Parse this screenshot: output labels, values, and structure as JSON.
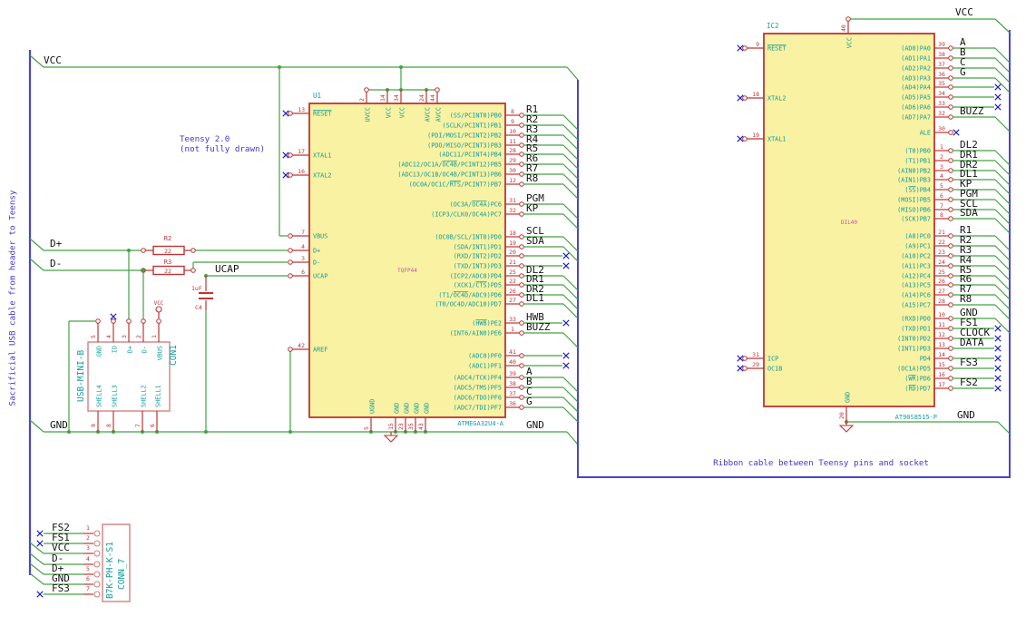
{
  "schematic": {
    "notes": {
      "teensy1": "Teensy 2.0",
      "teensy2": "(not fully drawn)",
      "ribbon": "Ribbon cable between Teensy pins and socket",
      "cable": "Sacrificial USB cable from header to Teensy"
    },
    "colors": {
      "wire": "#44a244",
      "pin": "#bf3434",
      "fill": "#f8f2a2",
      "name": "#109e9e",
      "value": "#c24fc2",
      "note": "#4238cc",
      "frame": "#4a44cc",
      "nc": "#1818c8",
      "label": "#141414",
      "connector": "#d47f7f"
    },
    "net_labels": {
      "vcc": "VCC",
      "gnd": "GND",
      "dplus": "D+",
      "dminus": "D-",
      "ucap": "UCAP"
    },
    "power_flag": "VCC",
    "resistors": [
      {
        "ref": "R2",
        "value": "22"
      },
      {
        "ref": "R3",
        "value": "22"
      }
    ],
    "capacitors": [
      {
        "ref": "C4",
        "value": "1uF"
      }
    ],
    "chips": [
      {
        "ref": "U1",
        "part": "ATMEGA32U4-A",
        "package": "TQFP44",
        "left": [
          {
            "num": "13",
            "name": "~RESET~",
            "nc": true
          },
          {
            "num": "17",
            "name": "XTAL1",
            "nc": true
          },
          {
            "num": "16",
            "name": "XTAL2",
            "nc": true
          },
          {
            "num": "7",
            "name": "VBUS"
          },
          {
            "num": "4",
            "name": "D+"
          },
          {
            "num": "3",
            "name": "D-"
          },
          {
            "num": "6",
            "name": "UCAP"
          },
          {
            "num": "42",
            "name": "AREF"
          }
        ],
        "top": [
          {
            "num": "2",
            "name": "UVCC"
          },
          {
            "num": "14",
            "name": "VCC"
          },
          {
            "num": "34",
            "name": "VCC"
          },
          {
            "num": "24",
            "name": "AVCC"
          },
          {
            "num": "44",
            "name": "AVCC"
          }
        ],
        "bottom": [
          {
            "num": "5",
            "name": "UGND"
          },
          {
            "num": "15",
            "name": "GND"
          },
          {
            "num": "23",
            "name": "GND"
          },
          {
            "num": "35",
            "name": "GND"
          },
          {
            "num": "43",
            "name": "GND"
          }
        ],
        "right": [
          {
            "num": "8",
            "name": "(SS/PCINT0)PB0",
            "label": "R1",
            "conn": "bus"
          },
          {
            "num": "9",
            "name": "(SCLK/PCINT1)PB1",
            "label": "R2",
            "conn": "bus"
          },
          {
            "num": "10",
            "name": "(PDI/MOSI/PCINT2)PB2",
            "label": "R3",
            "conn": "bus"
          },
          {
            "num": "11",
            "name": "(PDO/MISO/PCINT3)PB3",
            "label": "R4",
            "conn": "bus"
          },
          {
            "num": "28",
            "name": "(ADC11/PCINT4)PB4",
            "label": "R5",
            "conn": "bus"
          },
          {
            "num": "29",
            "name": "(ADC12/OC1A/~OC4B~/PCINT12)PB5",
            "label": "R6",
            "conn": "bus"
          },
          {
            "num": "30",
            "name": "(ADC13/OC1B/OC4B/PCINT13)PB6",
            "label": "R7",
            "conn": "bus"
          },
          {
            "num": "12",
            "name": "(OC0A/OC1C/~RTS~/PCINT7)PB7",
            "label": "R8",
            "conn": "bus"
          },
          {
            "num": "31",
            "name": "(OC3A/~OC4A~)PC6",
            "label": "PGM",
            "conn": "bus"
          },
          {
            "num": "32",
            "name": "(ICP3/CLK0/OC4A)PC7",
            "label": "KP",
            "conn": "bus"
          },
          {
            "num": "18",
            "name": "(OC0B/SCL/INT0)PD0",
            "label": "SCL",
            "conn": "bus"
          },
          {
            "num": "19",
            "name": "(SDA/INT1)PD1",
            "label": "SDA",
            "conn": "bus"
          },
          {
            "num": "20",
            "name": "(RXD/INT2)PD2",
            "label": "",
            "conn": "nc"
          },
          {
            "num": "21",
            "name": "(TXD/INT3)PD3",
            "label": "",
            "conn": "nc"
          },
          {
            "num": "25",
            "name": "(ICP2/ADC8)PD4",
            "label": "DL2",
            "conn": "bus"
          },
          {
            "num": "22",
            "name": "(XCK1/~CTS~)PD5",
            "label": "DR1",
            "conn": "bus"
          },
          {
            "num": "26",
            "name": "(T1/~OC4D~/ADC9)PD6",
            "label": "DR2",
            "conn": "bus"
          },
          {
            "num": "27",
            "name": "(T0/OC4D/ADC10)PD7",
            "label": "DL1",
            "conn": "bus"
          },
          {
            "num": "33",
            "name": "(~HWB~)PE2",
            "label": "HWB",
            "conn": "nc"
          },
          {
            "num": "1",
            "name": "(INT6/AIN0)PE6",
            "label": "BUZZ",
            "conn": "bus"
          },
          {
            "num": "41",
            "name": "(ADC0)PF0",
            "label": "",
            "conn": "nc"
          },
          {
            "num": "40",
            "name": "(ADC1)PF1",
            "label": "",
            "conn": "nc"
          },
          {
            "num": "39",
            "name": "(ADC4/TCK)PF4",
            "label": "A",
            "conn": "bus"
          },
          {
            "num": "38",
            "name": "(ADC5/TMS)PF5",
            "label": "B",
            "conn": "bus"
          },
          {
            "num": "37",
            "name": "(ADC6/TDO)PF6",
            "label": "C",
            "conn": "bus"
          },
          {
            "num": "36",
            "name": "(ADC7/TDI)PF7",
            "label": "G",
            "conn": "bus"
          }
        ]
      },
      {
        "ref": "IC2",
        "part": "AT90S8515-P",
        "package": "DIL40",
        "left": [
          {
            "num": "9",
            "name": "~RESET~",
            "nc": true
          },
          {
            "num": "18",
            "name": "XTAL2",
            "nc": true
          },
          {
            "num": "19",
            "name": "XTAL1",
            "nc": true
          },
          {
            "num": "31",
            "name": "ICP",
            "nc": true
          },
          {
            "num": "29",
            "name": "OC1B",
            "nc": true
          }
        ],
        "top": [
          {
            "num": "40",
            "name": "VCC"
          }
        ],
        "bottom": [
          {
            "num": "20",
            "name": "GND"
          }
        ],
        "right": [
          {
            "num": "39",
            "name": "(AD0)PA0",
            "label": "A",
            "conn": "bus"
          },
          {
            "num": "38",
            "name": "(AD1)PA1",
            "label": "B",
            "conn": "bus"
          },
          {
            "num": "37",
            "name": "(AD2)PA2",
            "label": "C",
            "conn": "bus"
          },
          {
            "num": "36",
            "name": "(AD3)PA3",
            "label": "G",
            "conn": "bus"
          },
          {
            "num": "35",
            "name": "(AD4)PA4",
            "label": "",
            "conn": "nc"
          },
          {
            "num": "34",
            "name": "(AD5)PA5",
            "label": "",
            "conn": "nc"
          },
          {
            "num": "33",
            "name": "(AD6)PA6",
            "label": "",
            "conn": "nc"
          },
          {
            "num": "32",
            "name": "(AD7)PA7",
            "label": "BUZZ",
            "conn": "bus"
          },
          {
            "num": "30",
            "name": "ALE",
            "label": "",
            "conn": "ncshort"
          },
          {
            "num": "1",
            "name": "(T0)PB0",
            "label": "DL2",
            "conn": "bus"
          },
          {
            "num": "2",
            "name": "(T1)PB1",
            "label": "DR1",
            "conn": "bus"
          },
          {
            "num": "3",
            "name": "(AIN0)PB2",
            "label": "DR2",
            "conn": "bus"
          },
          {
            "num": "4",
            "name": "(AIN1)PB3",
            "label": "DL1",
            "conn": "bus"
          },
          {
            "num": "5",
            "name": "(~SS~)PB4",
            "label": "KP",
            "conn": "bus"
          },
          {
            "num": "6",
            "name": "(MOSI)PB5",
            "label": "PGM",
            "conn": "bus"
          },
          {
            "num": "7",
            "name": "(MISO)PB6",
            "label": "SCL",
            "conn": "bus"
          },
          {
            "num": "8",
            "name": "(SCK)PB7",
            "label": "SDA",
            "conn": "bus"
          },
          {
            "num": "21",
            "name": "(A8)PC0",
            "label": "R1",
            "conn": "bus"
          },
          {
            "num": "22",
            "name": "(A9)PC1",
            "label": "R2",
            "conn": "bus"
          },
          {
            "num": "23",
            "name": "(A10)PC2",
            "label": "R3",
            "conn": "bus"
          },
          {
            "num": "24",
            "name": "(A11)PC3",
            "label": "R4",
            "conn": "bus"
          },
          {
            "num": "25",
            "name": "(A12)PC4",
            "label": "R5",
            "conn": "bus"
          },
          {
            "num": "26",
            "name": "(A13)PC5",
            "label": "R6",
            "conn": "bus"
          },
          {
            "num": "27",
            "name": "(A14)PC6",
            "label": "R7",
            "conn": "bus"
          },
          {
            "num": "28",
            "name": "(A15)PC7",
            "label": "R8",
            "conn": "bus"
          },
          {
            "num": "10",
            "name": "(RXD)PD0",
            "label": "GND",
            "conn": "bus"
          },
          {
            "num": "11",
            "name": "(TXD)PD1",
            "label": "FS1",
            "conn": "nc"
          },
          {
            "num": "12",
            "name": "(INT0)PD2",
            "label": "CLOCK",
            "conn": "nc"
          },
          {
            "num": "13",
            "name": "(INT1)PD3",
            "label": "DATA",
            "conn": "nc"
          },
          {
            "num": "14",
            "name": "PD4",
            "label": "",
            "conn": "nc"
          },
          {
            "num": "15",
            "name": "(OC1A)PD5",
            "label": "FS3",
            "conn": "nc"
          },
          {
            "num": "16",
            "name": "(~WR~)PD6",
            "label": "",
            "conn": "nc"
          },
          {
            "num": "17",
            "name": "(~RD~)PD7",
            "label": "FS2",
            "conn": "nc"
          }
        ]
      }
    ],
    "connectors": [
      {
        "ref": "CON1",
        "value": "USB-MINI-B",
        "top": [
          {
            "num": "5",
            "name": "GND"
          },
          {
            "num": "4",
            "name": "ID",
            "nc": true
          },
          {
            "num": "3",
            "name": "D+"
          },
          {
            "num": "2",
            "name": "D-"
          },
          {
            "num": "1",
            "name": "VBUS"
          }
        ],
        "bottom": [
          {
            "num": "9",
            "name": "SHELL4"
          },
          {
            "num": "8",
            "name": "SHELL3"
          },
          {
            "num": "7",
            "name": "SHELL2"
          },
          {
            "num": "6",
            "name": "SHELL1"
          }
        ]
      },
      {
        "ref": "CONN_7",
        "value": "B7K-PH-K-S1",
        "pins": [
          {
            "num": "1",
            "label": "FS2",
            "conn": "nc"
          },
          {
            "num": "2",
            "label": "FS1",
            "conn": "nc"
          },
          {
            "num": "3",
            "label": "VCC",
            "conn": "bus"
          },
          {
            "num": "4",
            "label": "D-",
            "conn": "bus"
          },
          {
            "num": "5",
            "label": "D+",
            "conn": "bus"
          },
          {
            "num": "6",
            "label": "GND",
            "conn": "bus"
          },
          {
            "num": "7",
            "label": "FS3",
            "conn": "nc"
          }
        ]
      }
    ]
  }
}
